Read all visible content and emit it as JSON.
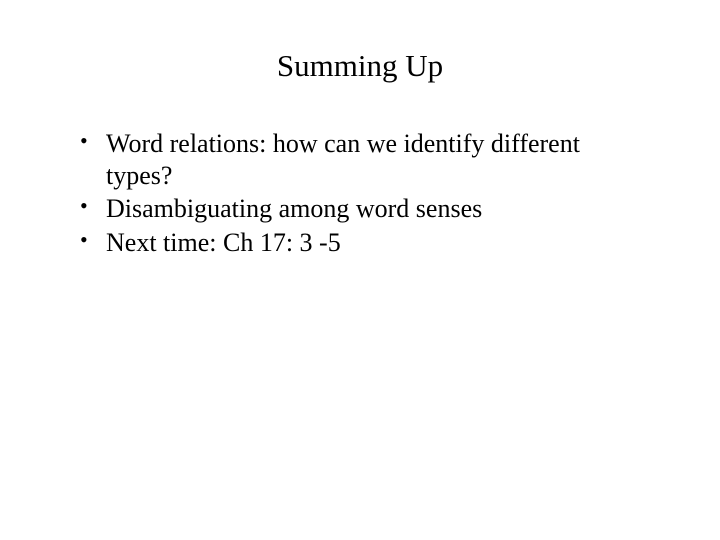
{
  "slide": {
    "title": "Summing Up",
    "bullets": [
      "Word relations: how can we identify different types?",
      "Disambiguating among word senses",
      "Next time: Ch 17: 3 -5"
    ]
  }
}
